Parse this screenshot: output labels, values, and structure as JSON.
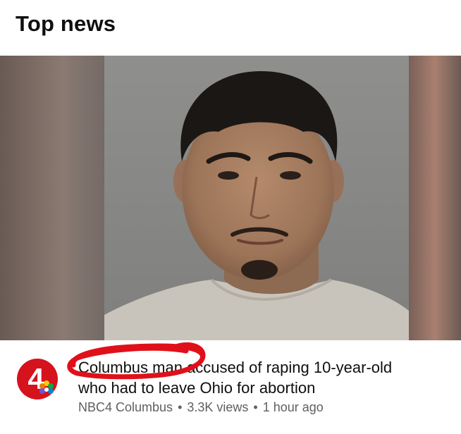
{
  "section": {
    "title": "Top news"
  },
  "video": {
    "title_line1": "Columbus man accused of raping 10-year-old",
    "title_line2": "who had to leave Ohio for abortion",
    "channel": "NBC4 Columbus",
    "views": "3.3K views",
    "age": "1 hour ago",
    "separator": "•",
    "channel_logo_text": "4"
  },
  "colors": {
    "title": "#0f0f0f",
    "meta": "#606060",
    "annotation": "#e0101a",
    "logo_red": "#d6121d"
  },
  "icons": {
    "channel_logo": "nbc4-logo-icon",
    "annotation": "red-circle-scribble"
  }
}
